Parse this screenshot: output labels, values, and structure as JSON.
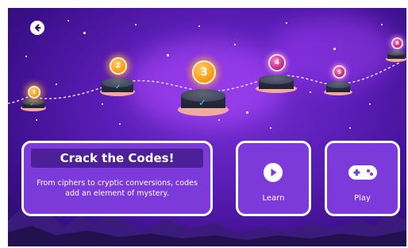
{
  "levels": [
    {
      "number": "1",
      "completed": true,
      "state": "done"
    },
    {
      "number": "2",
      "completed": true,
      "state": "done"
    },
    {
      "number": "3",
      "completed": true,
      "state": "current"
    },
    {
      "number": "4",
      "completed": false,
      "state": "locked"
    },
    {
      "number": "5",
      "completed": false,
      "state": "locked"
    },
    {
      "number": "6",
      "completed": false,
      "state": "locked"
    }
  ],
  "info_card": {
    "title": "Crack the Codes!",
    "description": "From ciphers to cryptic conversions, codes add an element of mystery."
  },
  "actions": {
    "learn_label": "Learn",
    "play_label": "Play"
  },
  "colors": {
    "background": "#5a1db6",
    "card": "#7b3ad9",
    "title_bar": "#4d1f99",
    "badge_done": "#ffa21a",
    "badge_locked": "#c9348e",
    "checkmark": "#38d3ff"
  },
  "icons": {
    "back": "back-arrow-icon",
    "learn": "play-circle-icon",
    "play": "gamepad-icon"
  }
}
